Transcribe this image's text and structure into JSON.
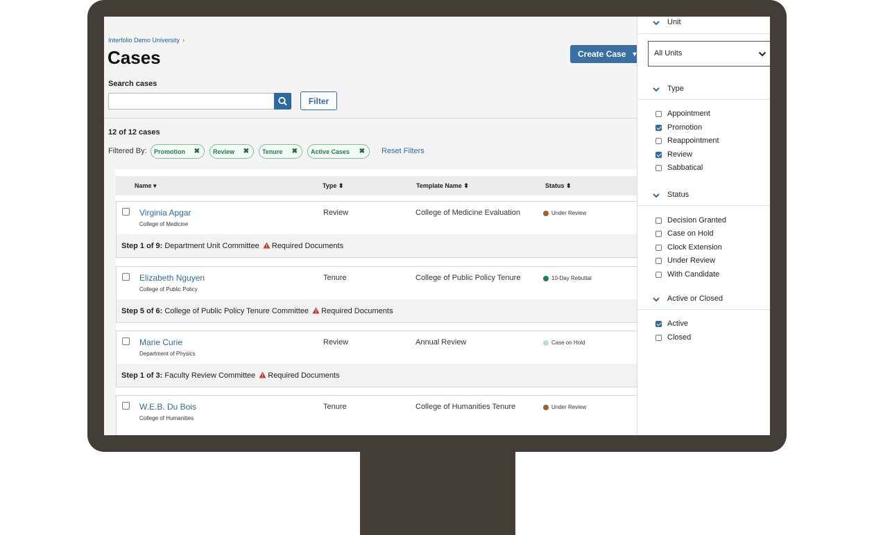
{
  "breadcrumb": {
    "university": "Interfolio Demo University",
    "separator": "›"
  },
  "page": {
    "title": "Cases"
  },
  "actions": {
    "create_case": "Create Case"
  },
  "search": {
    "label": "Search cases",
    "placeholder": "",
    "filter_button": "Filter"
  },
  "results": {
    "count": "12 of 12 cases",
    "filtered_by": "Filtered By:",
    "reset": "Reset Filters"
  },
  "chips": [
    {
      "label": "Promotion"
    },
    {
      "label": "Review"
    },
    {
      "label": "Tenure"
    },
    {
      "label": "Active Cases"
    }
  ],
  "table": {
    "headers": {
      "name": "Name",
      "type": "Type",
      "template": "Template Name",
      "status": "Status"
    },
    "rows": [
      {
        "name": "Virginia Apgar",
        "college": "College of Medicine",
        "type": "Review",
        "template": "College of Medicine Evaluation",
        "status": "Under Review",
        "status_color": "#a0622a",
        "step_prefix": "Step 1 of 9:",
        "step_text": "Department Unit Committee",
        "step_warning": "Required Documents"
      },
      {
        "name": "Elizabeth Nguyen",
        "college": "College of Public Policy",
        "type": "Tenure",
        "template": "College of Public Policy Tenure",
        "status": "10-Day Rebuttal",
        "status_color": "#1e7a5a",
        "step_prefix": "Step 5 of 6:",
        "step_text": "College of Public Policy Tenure Committee",
        "step_warning": "Required Documents"
      },
      {
        "name": "Marie Curie",
        "college": "Department of Physics",
        "type": "Review",
        "template": "Annual Review",
        "status": "Case on Hold",
        "status_color": "#b8d8ea",
        "step_prefix": "Step 1 of 3:",
        "step_text": "Faculty Review Committee",
        "step_warning": "Required Documents"
      },
      {
        "name": "W.E.B. Du Bois",
        "college": "College of Humanities",
        "type": "Tenure",
        "template": "College of Humanities Tenure",
        "status": "Under Review",
        "status_color": "#a0622a",
        "step_prefix": "",
        "step_text": "",
        "step_warning": ""
      }
    ]
  },
  "sidebar": {
    "unit": {
      "heading": "Unit",
      "selected": "All Units"
    },
    "type": {
      "heading": "Type",
      "options": [
        {
          "label": "Appointment",
          "checked": false
        },
        {
          "label": "Promotion",
          "checked": true
        },
        {
          "label": "Reappointment",
          "checked": false
        },
        {
          "label": "Review",
          "checked": true
        },
        {
          "label": "Sabbatical",
          "checked": false
        }
      ]
    },
    "status": {
      "heading": "Status",
      "options": [
        {
          "label": "Decision Granted",
          "checked": false
        },
        {
          "label": "Case on Hold",
          "checked": false
        },
        {
          "label": "Clock Extension",
          "checked": false
        },
        {
          "label": "Under Review",
          "checked": false
        },
        {
          "label": "With Candidate",
          "checked": false
        }
      ]
    },
    "active": {
      "heading": "Active or Closed",
      "options": [
        {
          "label": "Active",
          "checked": true
        },
        {
          "label": "Closed",
          "checked": false
        }
      ]
    }
  },
  "colors": {
    "accent": "#2e6aa0",
    "chip_text": "#2d7a4f",
    "warning": "#c0392b",
    "bezel": "#423e37"
  }
}
